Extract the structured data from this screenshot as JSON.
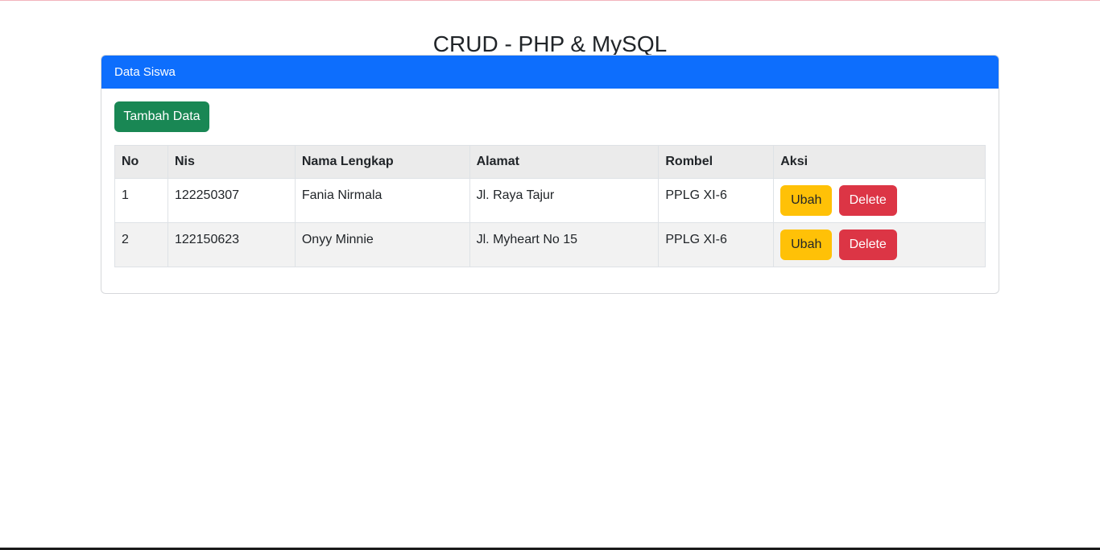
{
  "header": {
    "title": "CRUD - PHP & MySQL"
  },
  "card": {
    "title": "Data Siswa",
    "add_button_label": "Tambah Data",
    "accent_color": "#0d6efd"
  },
  "table": {
    "columns": [
      "No",
      "Nis",
      "Nama Lengkap",
      "Alamat",
      "Rombel",
      "Aksi"
    ],
    "rows": [
      {
        "no": "1",
        "nis": "122250307",
        "nama": "Fania Nirmala",
        "alamat": "Jl. Raya Tajur",
        "rombel": "PPLG XI-6",
        "edit_label": "Ubah",
        "delete_label": "Delete"
      },
      {
        "no": "2",
        "nis": "122150623",
        "nama": "Onyy Minnie",
        "alamat": "Jl. Myheart No 15",
        "rombel": "PPLG XI-6",
        "edit_label": "Ubah",
        "delete_label": "Delete"
      }
    ]
  },
  "colors": {
    "add_button": "#198754",
    "edit_button": "#ffc107",
    "delete_button": "#dc3545"
  }
}
